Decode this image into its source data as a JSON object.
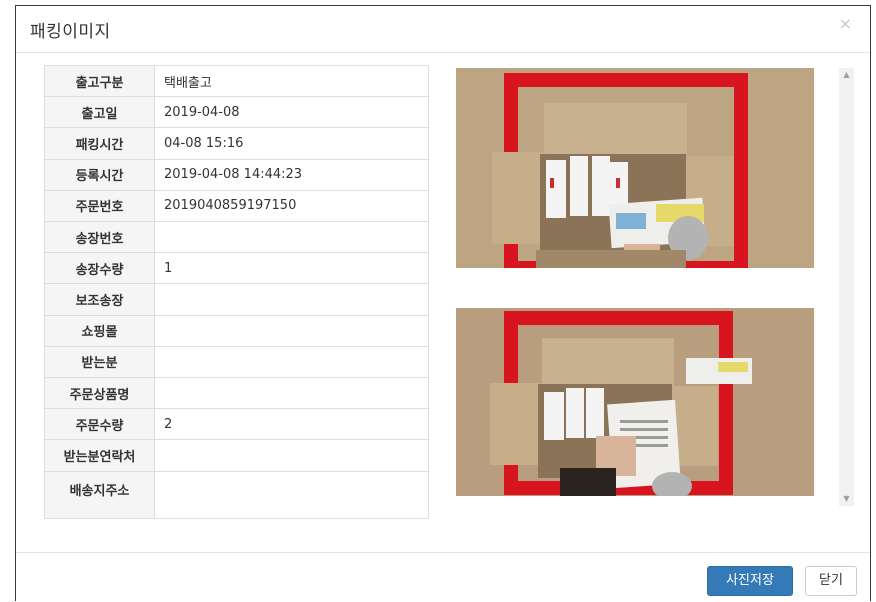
{
  "modal": {
    "title": "패킹이미지",
    "close_icon": "close-icon"
  },
  "info": {
    "rows": [
      {
        "key": "출고구분",
        "value": "택배출고"
      },
      {
        "key": "출고일",
        "value": "2019-04-08"
      },
      {
        "key": "패킹시간",
        "value": "04-08 15:16"
      },
      {
        "key": "등록시간",
        "value": "2019-04-08 14:44:23"
      },
      {
        "key": "주문번호",
        "value": "2019040859197150"
      },
      {
        "key": "송장번호",
        "value": ""
      },
      {
        "key": "송장수량",
        "value": "1"
      },
      {
        "key": "보조송장",
        "value": ""
      },
      {
        "key": "쇼핑몰",
        "value": ""
      },
      {
        "key": "받는분",
        "value": ""
      },
      {
        "key": "주문상품명",
        "value": ""
      },
      {
        "key": "주문수량",
        "value": "2"
      },
      {
        "key": "받는분연락처",
        "value": ""
      },
      {
        "key": "배송지주소",
        "value": ""
      }
    ]
  },
  "footer": {
    "save_label": "사진저장",
    "close_label": "닫기"
  },
  "colors": {
    "primary": "#337ab7",
    "table_header_bg": "#f5f5f5",
    "border": "#dddddd"
  }
}
